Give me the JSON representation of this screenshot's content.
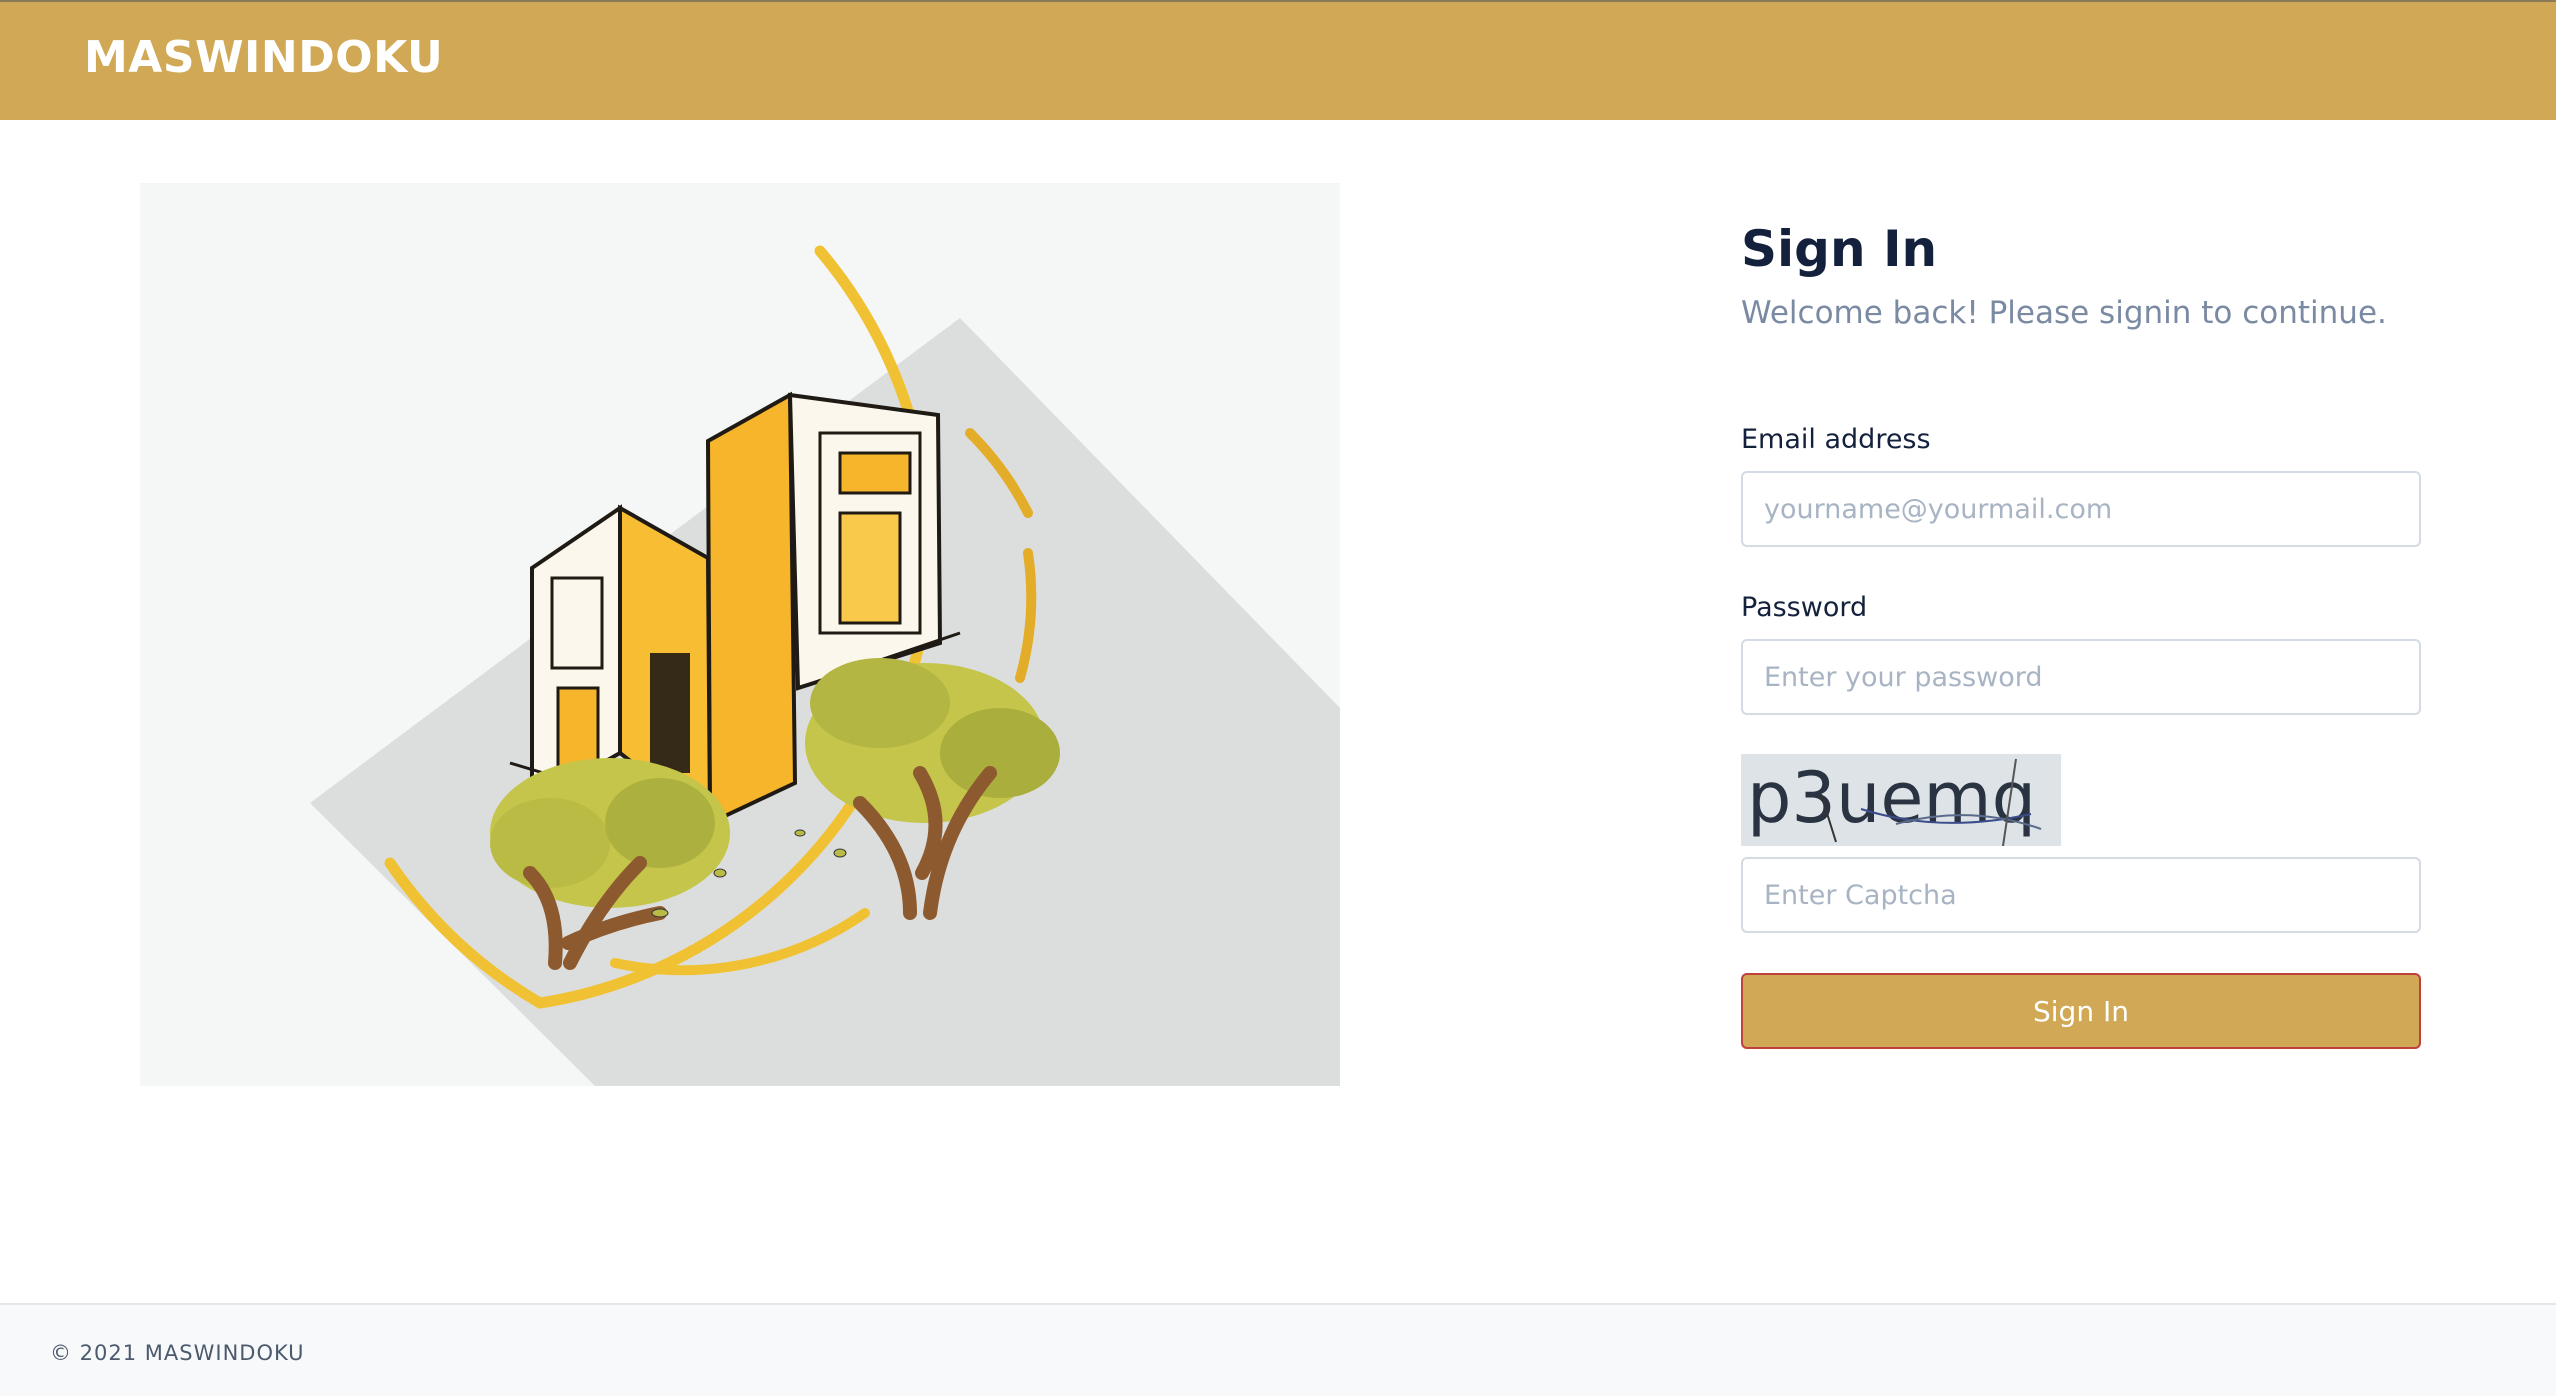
{
  "header": {
    "brand": "MASWINDOKU"
  },
  "login": {
    "title": "Sign In",
    "subtitle": "Welcome back! Please signin to continue.",
    "email_label": "Email address",
    "email_placeholder": "yourname@yourmail.com",
    "email_value": "",
    "password_label": "Password",
    "password_placeholder": "Enter your password",
    "password_value": "",
    "captcha_text": "p3uemq",
    "captcha_placeholder": "Enter Captcha",
    "captcha_value": "",
    "submit_label": "Sign In"
  },
  "footer": {
    "copyright": "© 2021 MASWINDOKU"
  },
  "colors": {
    "brand": "#d1a855",
    "button_border": "#c0403a",
    "title": "#14213d",
    "subtitle": "#7b8aa3"
  }
}
